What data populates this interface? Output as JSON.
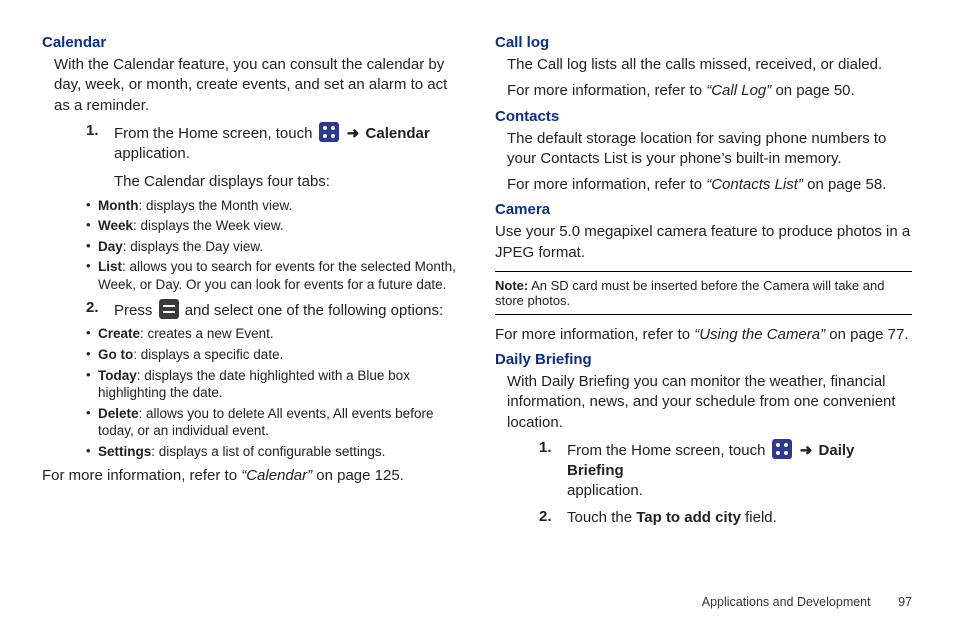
{
  "left": {
    "calendar": {
      "heading": "Calendar",
      "intro": "With the Calendar feature, you can consult the calendar by day, week, or month, create events, and set an alarm to act as a reminder.",
      "step1_num": "1.",
      "step1_a": "From the Home screen, touch ",
      "step1_b": " Calendar",
      "step1_c": "application.",
      "step1_sub": "The Calendar displays four tabs:",
      "tabs": {
        "month_l": "Month",
        "month_t": ": displays the Month view.",
        "week_l": "Week",
        "week_t": ": displays the Week view.",
        "day_l": "Day",
        "day_t": ": displays the Day view.",
        "list_l": "List",
        "list_t": ": allows you to search for events for the selected Month, Week, or Day. Or you can look for events for a future date."
      },
      "step2_num": "2.",
      "step2_a": "Press ",
      "step2_b": " and select one of the following options:",
      "opts": {
        "create_l": "Create",
        "create_t": ": creates a new Event.",
        "goto_l": "Go to",
        "goto_t": ": displays a specific date.",
        "today_l": "Today",
        "today_t": ": displays the date highlighted with a Blue box highlighting the date.",
        "delete_l": "Delete",
        "delete_t": ": allows you to delete All events, All events before today, or an individual event.",
        "settings_l": "Settings",
        "settings_t": ": displays a list of configurable settings."
      },
      "more_a": "For more information, refer to ",
      "more_ref": "“Calendar” ",
      "more_b": " on page 125."
    }
  },
  "right": {
    "calllog": {
      "heading": "Call log",
      "line1": "The Call log lists all the calls missed, received, or dialed.",
      "more_a": "For more information, refer to ",
      "more_ref": "“Call Log” ",
      "more_b": " on page 50."
    },
    "contacts": {
      "heading": "Contacts",
      "line1": "The default storage location for saving phone numbers to your Contacts List is your phone’s built-in memory.",
      "more_a": "For more information, refer to ",
      "more_ref": "“Contacts List” ",
      "more_b": " on page 58."
    },
    "camera": {
      "heading": "Camera",
      "line1": "Use your 5.0 megapixel camera feature to produce photos in a JPEG format.",
      "note_label": "Note:",
      "note_text": " An SD card must be inserted before the Camera will take and store photos.",
      "more_a": "For more information, refer to ",
      "more_ref": "“Using the Camera” ",
      "more_b": " on page 77."
    },
    "daily": {
      "heading": "Daily Briefing",
      "line1": "With Daily Briefing you can monitor the weather, financial information, news, and your schedule from one convenient location.",
      "step1_num": "1.",
      "step1_a": "From the Home screen, touch ",
      "step1_b": " Daily Briefing",
      "step1_c": "application.",
      "step2_num": "2.",
      "step2_a": "Touch the ",
      "step2_b": "Tap to add city",
      "step2_c": " field."
    }
  },
  "footer": {
    "section": "Applications and Development",
    "page": "97"
  },
  "glyphs": {
    "arrow": "➜"
  }
}
